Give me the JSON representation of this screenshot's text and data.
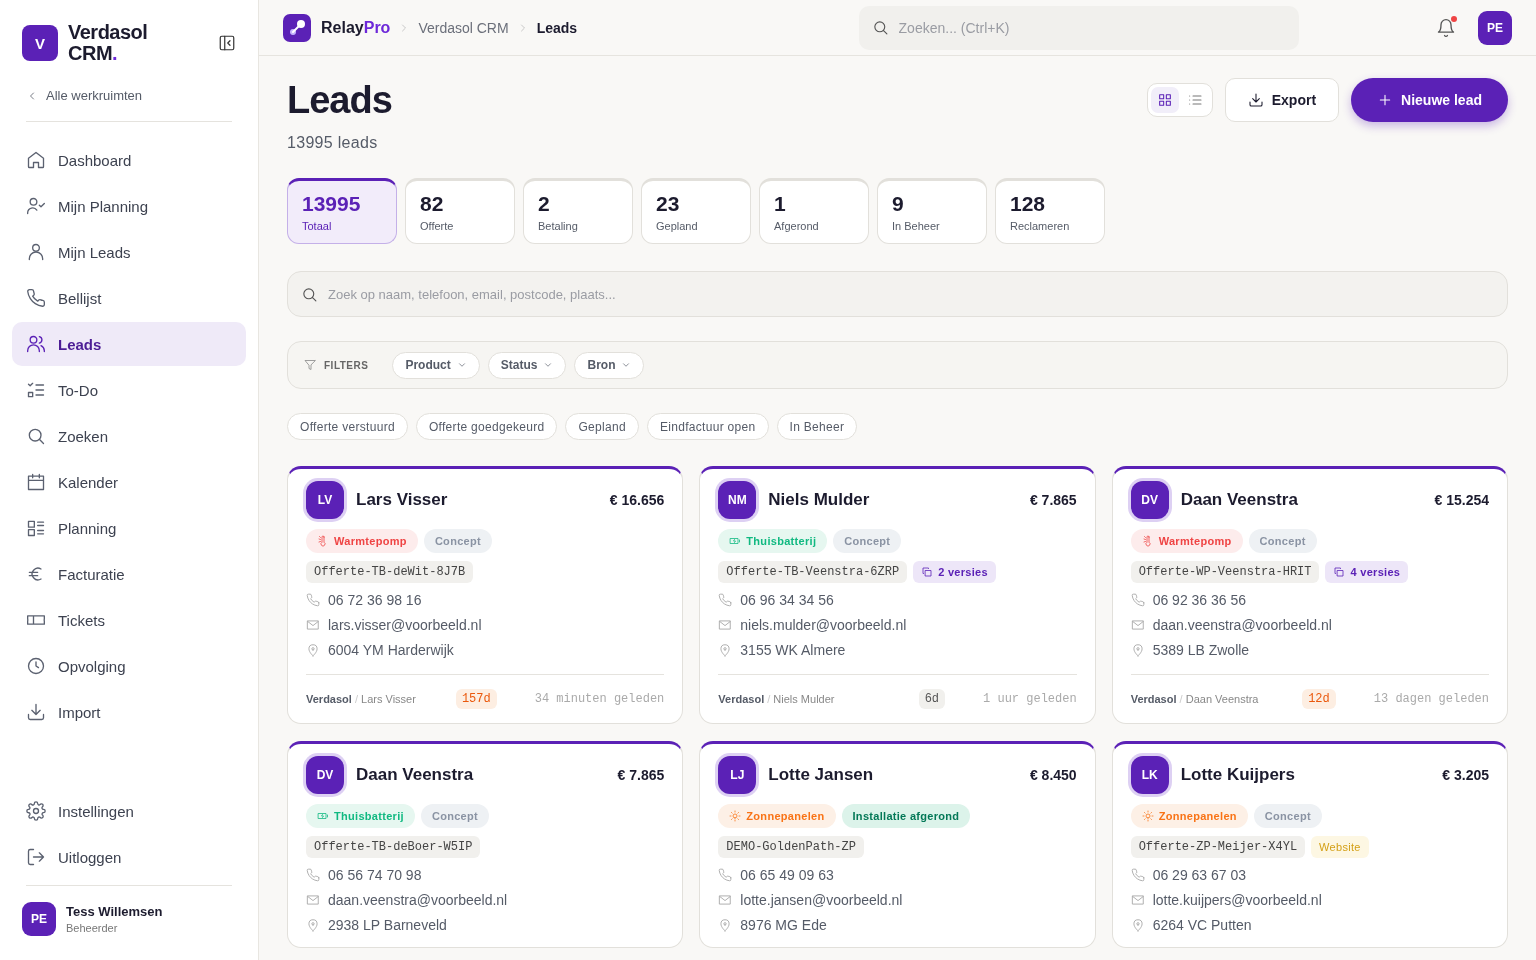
{
  "sidebar": {
    "logo_letter": "V",
    "brand": "Verdasol",
    "brand_line2": "CRM",
    "brand_dot": ".",
    "back_link": "Alle werkruimten",
    "items": [
      {
        "label": "Dashboard",
        "selected": false
      },
      {
        "label": "Mijn Planning",
        "selected": false
      },
      {
        "label": "Mijn Leads",
        "selected": false
      },
      {
        "label": "Bellijst",
        "selected": false
      },
      {
        "label": "Leads",
        "selected": true
      },
      {
        "label": "To-Do",
        "selected": false
      },
      {
        "label": "Zoeken",
        "selected": false
      },
      {
        "label": "Kalender",
        "selected": false
      },
      {
        "label": "Planning",
        "selected": false
      },
      {
        "label": "Facturatie",
        "selected": false
      },
      {
        "label": "Tickets",
        "selected": false
      },
      {
        "label": "Opvolging",
        "selected": false
      },
      {
        "label": "Import",
        "selected": false
      }
    ],
    "bottom_items": [
      {
        "label": "Instellingen"
      },
      {
        "label": "Uitloggen"
      }
    ],
    "user": {
      "initials": "PE",
      "name": "Tess Willemsen",
      "role": "Beheerder"
    }
  },
  "topbar": {
    "app_name": "Relay",
    "app_name_accent": "Pro",
    "breadcrumbs": [
      "Verdasol CRM",
      "Leads"
    ],
    "search": {
      "placeholder": "Zoeken... (Ctrl+K)"
    },
    "notification_dot": true,
    "avatar": "PE"
  },
  "header": {
    "title": "Leads",
    "subtitle": "13995 leads",
    "view_toggle": [
      {
        "kind": "grid",
        "selected": true
      },
      {
        "kind": "list",
        "selected": false
      }
    ],
    "export_button": "Export",
    "new_button": "Nieuwe lead"
  },
  "stats": [
    {
      "value": "13995",
      "label": "Totaal",
      "selected": true
    },
    {
      "value": "82",
      "label": "Offerte",
      "selected": false
    },
    {
      "value": "2",
      "label": "Betaling",
      "selected": false
    },
    {
      "value": "23",
      "label": "Gepland",
      "selected": false
    },
    {
      "value": "1",
      "label": "Afgerond",
      "selected": false
    },
    {
      "value": "9",
      "label": "In Beheer",
      "selected": false
    },
    {
      "value": "128",
      "label": "Reclameren",
      "selected": false
    }
  ],
  "search": {
    "placeholder": "Zoek op naam, telefoon, email, postcode, plaats..."
  },
  "filters": {
    "label": "FILTERS",
    "dropdowns": [
      "Product",
      "Status",
      "Bron"
    ]
  },
  "quick_filters": [
    {
      "label": "Offerte verstuurd",
      "selected": false
    },
    {
      "label": "Offerte goedgekeurd",
      "selected": false
    },
    {
      "label": "Gepland",
      "selected": false
    },
    {
      "label": "Eindfactuur open",
      "selected": false
    },
    {
      "label": "In Beheer",
      "selected": false
    }
  ],
  "leads": [
    {
      "initials": "LV",
      "name": "Lars Visser",
      "amount": "€ 16.656",
      "product": {
        "kind": "warmtepomp",
        "label": "Warmtepomp"
      },
      "status": {
        "kind": "concept",
        "label": "Concept"
      },
      "reference": "Offerte-TB-deWit-8J7B",
      "phone": "06 72 36 98 16",
      "email": "lars.visser@voorbeeld.nl",
      "address": "6004 YM Harderwijk",
      "company": "Verdasol",
      "separator": "/",
      "contact": "Lars Visser",
      "age": {
        "label": "157d",
        "kind": "warn"
      },
      "updated": "34 minuten geleden"
    },
    {
      "initials": "NM",
      "name": "Niels Mulder",
      "amount": "€ 7.865",
      "product": {
        "kind": "thuisbatterij",
        "label": "Thuisbatterij"
      },
      "status": {
        "kind": "concept",
        "label": "Concept"
      },
      "reference": "Offerte-TB-Veenstra-6ZRP",
      "extra": {
        "kind": "versions",
        "label": "2 versies"
      },
      "phone": "06 96 34 34 56",
      "email": "niels.mulder@voorbeeld.nl",
      "address": "3155 WK Almere",
      "company": "Verdasol",
      "separator": "/",
      "contact": "Niels Mulder",
      "age": {
        "label": "6d",
        "kind": "normal"
      },
      "updated": "1 uur geleden"
    },
    {
      "initials": "DV",
      "name": "Daan Veenstra",
      "amount": "€ 15.254",
      "product": {
        "kind": "warmtepomp",
        "label": "Warmtepomp"
      },
      "status": {
        "kind": "concept",
        "label": "Concept"
      },
      "reference": "Offerte-WP-Veenstra-HRIT",
      "extra": {
        "kind": "versions",
        "label": "4 versies"
      },
      "phone": "06 92 36 36 56",
      "email": "daan.veenstra@voorbeeld.nl",
      "address": "5389 LB Zwolle",
      "company": "Verdasol",
      "separator": "/",
      "contact": "Daan Veenstra",
      "age": {
        "label": "12d",
        "kind": "warn"
      },
      "updated": "13 dagen geleden"
    },
    {
      "initials": "DV",
      "name": "Daan Veenstra",
      "amount": "€ 7.865",
      "product": {
        "kind": "thuisbatterij",
        "label": "Thuisbatterij"
      },
      "status": {
        "kind": "concept",
        "label": "Concept"
      },
      "reference": "Offerte-TB-deBoer-W5IP",
      "phone": "06 56 74 70 98",
      "email": "daan.veenstra@voorbeeld.nl",
      "address": "2938 LP Barneveld"
    },
    {
      "initials": "LJ",
      "name": "Lotte Jansen",
      "amount": "€ 8.450",
      "product": {
        "kind": "zonnepanelen",
        "label": "Zonnepanelen"
      },
      "status": {
        "kind": "done",
        "label": "Installatie afgerond"
      },
      "reference": "DEMO-GoldenPath-ZP",
      "phone": "06 65 49 09 63",
      "email": "lotte.jansen@voorbeeld.nl",
      "address": "8976 MG Ede"
    },
    {
      "initials": "LK",
      "name": "Lotte Kuijpers",
      "amount": "€ 3.205",
      "product": {
        "kind": "zonnepanelen",
        "label": "Zonnepanelen"
      },
      "status": {
        "kind": "concept",
        "label": "Concept"
      },
      "reference": "Offerte-ZP-Meijer-X4YL",
      "extra": {
        "kind": "source",
        "label": "Website"
      },
      "phone": "06 29 63 67 03",
      "email": "lotte.kuijpers@voorbeeld.nl",
      "address": "6264 VC Putten"
    }
  ]
}
